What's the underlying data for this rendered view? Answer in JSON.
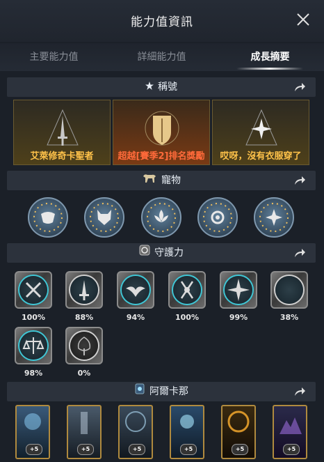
{
  "header": {
    "title": "能力值資訊"
  },
  "tabs": [
    {
      "label": "主要能力值"
    },
    {
      "label": "詳細能力值"
    },
    {
      "label": "成長摘要"
    }
  ],
  "sections": {
    "titles": {
      "label": "稱號"
    },
    "pets": {
      "label": "寵物"
    },
    "guardian": {
      "label": "守護力"
    },
    "arcana": {
      "label": "阿爾卡那"
    }
  },
  "title_cards": [
    {
      "label": "艾萊修奇卡聖者"
    },
    {
      "label": "超越[賽季2]排名獎勵"
    },
    {
      "label": "哎呀，沒有衣服穿了"
    }
  ],
  "guardians": [
    {
      "percent": "100%"
    },
    {
      "percent": "88%"
    },
    {
      "percent": "94%"
    },
    {
      "percent": "100%"
    },
    {
      "percent": "99%"
    },
    {
      "percent": "38%"
    },
    {
      "percent": "98%"
    },
    {
      "percent": "0%"
    }
  ],
  "arcana_cards": [
    {
      "badge": "+5"
    },
    {
      "badge": "+5"
    },
    {
      "badge": "+5"
    },
    {
      "badge": "+5"
    },
    {
      "badge": "+5"
    },
    {
      "badge": "+5"
    }
  ],
  "colors": {
    "background": "#1b2028",
    "section_bar": "#2c323c",
    "title_label": "#ffc24a",
    "guardian_ring": "#3ec7d6",
    "card_border": "#b08a3e"
  },
  "icons": {
    "close": "close-icon",
    "share": "share-arrow-icon",
    "titles": "star-icon",
    "pets": "pet-icon",
    "guardian": "guardian-icon",
    "arcana": "arcana-icon"
  }
}
